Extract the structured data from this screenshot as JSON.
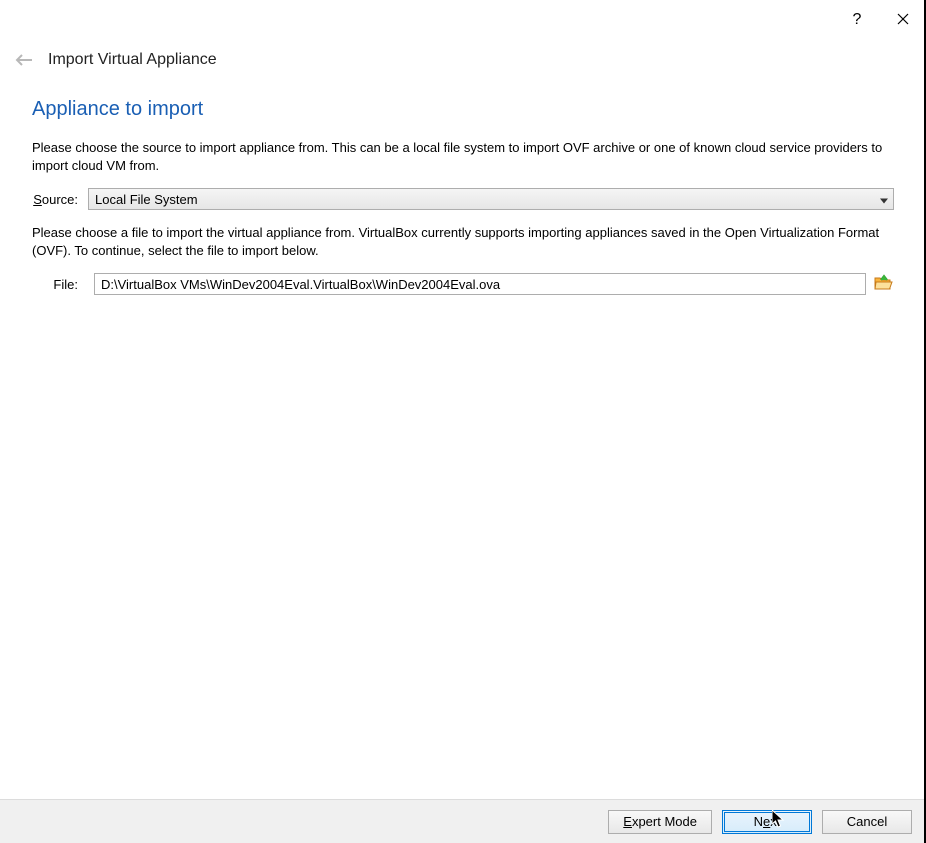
{
  "titlebar": {
    "help_tooltip": "?",
    "close_tooltip": "Close"
  },
  "header": {
    "title": "Import Virtual Appliance"
  },
  "section": {
    "heading": "Appliance to import",
    "source_desc": "Please choose the source to import appliance from. This can be a local file system to import OVF archive or one of known cloud service providers to import cloud VM from.",
    "file_desc": "Please choose a file to import the virtual appliance from. VirtualBox currently supports importing appliances saved in the Open Virtualization Format (OVF). To continue, select the file to import below."
  },
  "form": {
    "source_label_pre": "S",
    "source_label_post": "ource:",
    "source_value": "Local File System",
    "file_label_pre": "F",
    "file_label_post": "ile:",
    "file_value": "D:\\VirtualBox VMs\\WinDev2004Eval.VirtualBox\\WinDev2004Eval.ova"
  },
  "buttons": {
    "expert_pre": "E",
    "expert_post": "xpert Mode",
    "next_pre": "N",
    "next_mid": "e",
    "next_post": "xt",
    "cancel": "Cancel"
  }
}
